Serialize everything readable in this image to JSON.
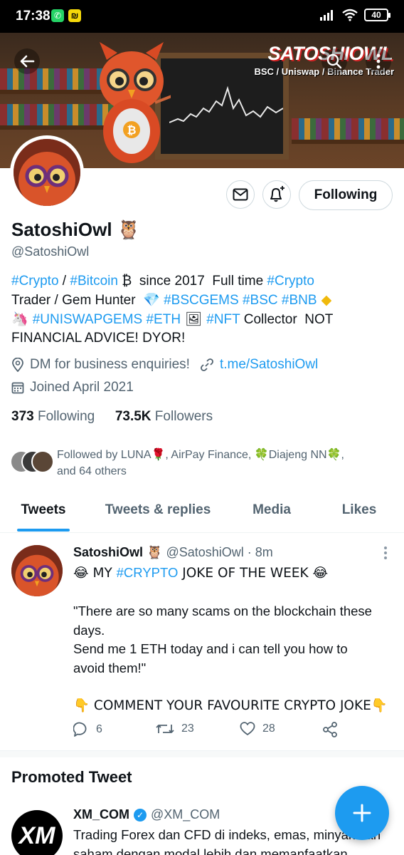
{
  "status_bar": {
    "time": "17:38",
    "apps": [
      "whatsapp-icon",
      "wallet-app-icon"
    ],
    "battery": "40",
    "icons": [
      "signal-icon",
      "wifi-icon",
      "battery-icon"
    ]
  },
  "banner": {
    "title": "SATOSHIOWL",
    "subtitle": "BSC / Uniswap / Binance Trader"
  },
  "actions": {
    "following_label": "Following"
  },
  "profile": {
    "name": "SatoshiOwl",
    "name_emoji": "🦉",
    "handle": "@SatoshiOwl"
  },
  "bio": {
    "line1_a": "#Crypto",
    "line1_b": " / ",
    "line1_c": "#Bitcoin",
    "line1_d": " ₿  since 2017  Full time ",
    "line1_e": "#Crypto",
    "line2_a": "Trader / Gem Hunter  ",
    "line2_b": "💎",
    "line2_c": " #BSCGEMS",
    "line2_d": " #BSC",
    "line2_e": " #BNB",
    "line2_f": " ◆",
    "line3_a": "🦄 ",
    "line3_b": "#UNISWAPGEMS",
    "line3_c": " #ETH",
    "line3_d": " 🖼 ",
    "line3_e": "#NFT",
    "line3_f": " Collector  NOT",
    "line4": "FINANCIAL ADVICE! DYOR!"
  },
  "meta": {
    "location": "DM for business enquiries!",
    "link": "t.me/SatoshiOwl",
    "joined": "Joined April 2021"
  },
  "stats": {
    "following_count": "373",
    "following_label": "Following",
    "followers_count": "73.5K",
    "followers_label": "Followers"
  },
  "followed_by": {
    "line1": "Followed by LUNA🌹, AirPay Finance, 🍀Diajeng NN🍀,",
    "line2": "and 64 others"
  },
  "tabs": [
    {
      "label": "Tweets",
      "active": true
    },
    {
      "label": "Tweets & replies",
      "active": false
    },
    {
      "label": "Media",
      "active": false
    },
    {
      "label": "Likes",
      "active": false
    }
  ],
  "tweet": {
    "name": "SatoshiOwl",
    "name_emoji": "🦉",
    "handle": "@SatoshiOwl · 8m",
    "line1_a": "😂 MY ",
    "line1_b": "#CRYPTO",
    "line1_c": " JOKE OF THE WEEK 😂",
    "line2": "\"There are so many scams on the blockchain these",
    "line3": "days.",
    "line4": "Send me 1 ETH today and i can tell you how to",
    "line5": "avoid them!\"",
    "line6": "👇 COMMENT YOUR FAVOURITE CRYPTO JOKE👇",
    "replies": "6",
    "retweets": "23",
    "likes": "28"
  },
  "promoted": {
    "section_title": "Promoted Tweet",
    "avatar_text": "XM",
    "name": "XM_COM",
    "handle": "@XM_COM",
    "line1": "Trading Forex dan CFD di indeks, emas, minyak dan",
    "line2": "saham dengan modal lebih dan memanfaatkan"
  },
  "colors": {
    "accent": "#1d9bf0",
    "text": "#0f1419",
    "muted": "#536471"
  }
}
